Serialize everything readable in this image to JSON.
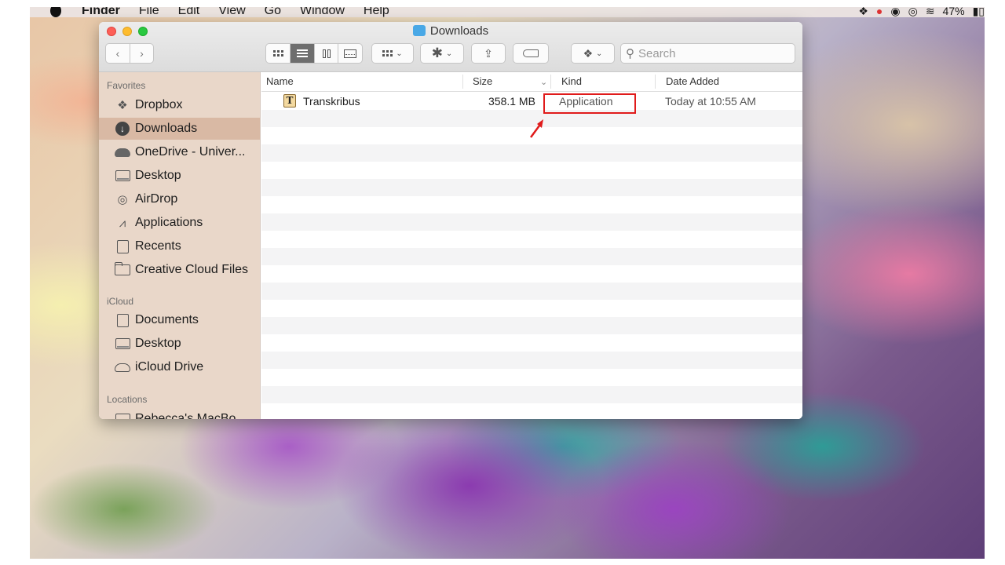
{
  "menubar": {
    "app_name": "Finder",
    "items": [
      "File",
      "Edit",
      "View",
      "Go",
      "Window",
      "Help"
    ],
    "battery": "47%"
  },
  "window": {
    "title": "Downloads",
    "search_placeholder": "Search"
  },
  "sidebar": {
    "sections": [
      {
        "header": "Favorites",
        "items": [
          {
            "label": "Dropbox",
            "icon": "dropbox-icon"
          },
          {
            "label": "Downloads",
            "icon": "downloads-icon",
            "selected": true
          },
          {
            "label": "OneDrive - Univer...",
            "icon": "onedrive-icon"
          },
          {
            "label": "Desktop",
            "icon": "desktop-icon"
          },
          {
            "label": "AirDrop",
            "icon": "airdrop-icon"
          },
          {
            "label": "Applications",
            "icon": "applications-icon"
          },
          {
            "label": "Recents",
            "icon": "recents-icon"
          },
          {
            "label": "Creative Cloud Files",
            "icon": "folder-icon"
          }
        ]
      },
      {
        "header": "iCloud",
        "items": [
          {
            "label": "Documents",
            "icon": "documents-icon"
          },
          {
            "label": "Desktop",
            "icon": "desktop-icon"
          },
          {
            "label": "iCloud Drive",
            "icon": "cloud-icon"
          }
        ]
      },
      {
        "header": "Locations",
        "items": [
          {
            "label": "Rebecca's MacBo...",
            "icon": "laptop-icon"
          }
        ]
      }
    ]
  },
  "list": {
    "columns": {
      "name": "Name",
      "size": "Size",
      "kind": "Kind",
      "date_added": "Date Added"
    },
    "rows": [
      {
        "name": "Transkribus",
        "size": "358.1 MB",
        "kind": "Application",
        "date_added": "Today at 10:55 AM",
        "icon": "transkribus-app-icon"
      }
    ]
  },
  "annotation": {
    "highlight_color": "#e01b1b"
  }
}
